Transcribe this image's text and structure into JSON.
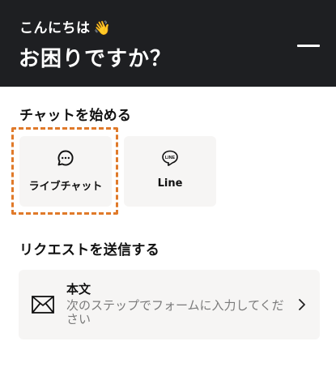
{
  "header": {
    "greeting": "こんにちは",
    "greeting_emoji": "👋",
    "headline": "お困りですか？",
    "minimize_icon": "minimize-icon"
  },
  "chat_section": {
    "title": "チャットを始める",
    "options": [
      {
        "label": "ライブチャット",
        "icon": "chat-bubble-icon",
        "focused": true
      },
      {
        "label": "Line",
        "icon": "line-logo-icon",
        "focused": false
      }
    ]
  },
  "request_section": {
    "title": "リクエストを送信する",
    "item": {
      "title": "本文",
      "description": "次のステップでフォームに入力してください",
      "icon": "envelope-icon",
      "chevron_icon": "chevron-right-icon"
    }
  },
  "colors": {
    "header_bg": "#1e1f22",
    "card_bg": "#f6f5f4",
    "focus_ring": "#e07a2a",
    "muted_text": "#7a7a7a"
  }
}
